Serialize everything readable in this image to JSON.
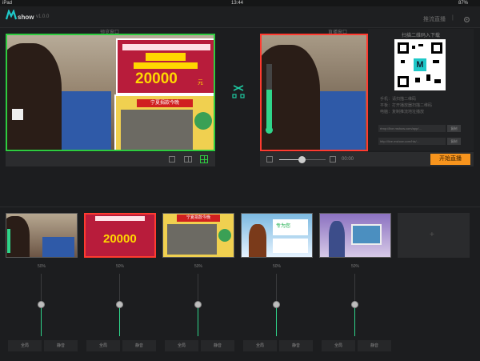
{
  "status_bar": {
    "device": "iPad",
    "time": "13:44",
    "battery": "87%"
  },
  "app": {
    "logo_letter": "M",
    "logo_text": "show",
    "version": "v1.0.0",
    "header_right": [
      "推流直播",
      "设置"
    ]
  },
  "preview": {
    "label": "预览窗口",
    "layout_icons": [
      "single-layout-icon",
      "split-layout-icon",
      "grid-layout-icon"
    ]
  },
  "program": {
    "label": "直播窗口",
    "time_code": "00:00",
    "start_button": "开始直播"
  },
  "qr_panel": {
    "title": "扫描二维码入下载",
    "qr_letter": "M",
    "info_lines": [
      "手机：请扫描二维码",
      "平板：打开播放器扫描二维码",
      "电脑：复制推流地址播放"
    ],
    "fields": [
      {
        "value": "rtmp://live.mshow.com/app/…",
        "copy": "复制"
      },
      {
        "value": "http://live.mshow.com/hls/…",
        "copy": "复制"
      }
    ]
  },
  "swap_icon": "shuffle-icon",
  "program_center_icon": "plus-icon",
  "sources": [
    {
      "percent": "50%",
      "btn1": "全局",
      "btn2": "静音"
    },
    {
      "percent": "50%",
      "btn1": "全局",
      "btn2": "静音"
    },
    {
      "percent": "50%",
      "btn1": "全局",
      "btn2": "静音"
    },
    {
      "percent": "50%",
      "btn1": "全局",
      "btn2": "静音"
    },
    {
      "percent": "50%",
      "btn1": "全局",
      "btn2": "静音"
    }
  ],
  "add_source_icon": "plus-icon",
  "overlay_text": {
    "big_number": "20000",
    "big_number_unit": "元",
    "sub_banner": "宁夏捐款今晚",
    "thumb1_text": "专为您",
    "thumb2_text": "20000",
    "thumb3_text": "宁夏捐款今晚"
  },
  "colors": {
    "accent": "#f7941d",
    "preview_border": "#2ecc40",
    "program_border": "#ff3b30",
    "level": "#2fd48a"
  }
}
